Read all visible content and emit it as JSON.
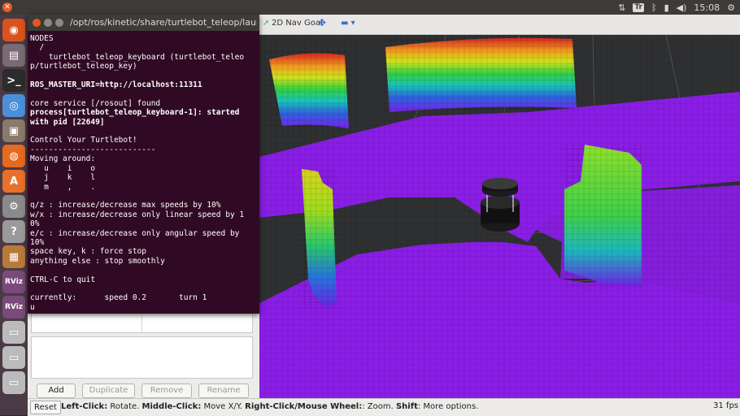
{
  "top_panel": {
    "keyboard_indicator": "Tr",
    "clock": "15:08"
  },
  "launcher": {
    "items": [
      {
        "name": "ubuntu-dash",
        "glyph": "◉"
      },
      {
        "name": "files",
        "glyph": "▤"
      },
      {
        "name": "terminal",
        "glyph": ">_"
      },
      {
        "name": "chromium",
        "glyph": "◎"
      },
      {
        "name": "file-manager",
        "glyph": "▣"
      },
      {
        "name": "firefox",
        "glyph": "◍"
      },
      {
        "name": "software-center",
        "glyph": "A"
      },
      {
        "name": "settings",
        "glyph": "⚙"
      },
      {
        "name": "help",
        "glyph": "?"
      },
      {
        "name": "package",
        "glyph": "▦"
      },
      {
        "name": "rviz-1",
        "glyph": "RViz"
      },
      {
        "name": "rviz-2",
        "glyph": "RViz"
      },
      {
        "name": "drive-1",
        "glyph": "▭"
      },
      {
        "name": "drive-2",
        "glyph": "▭"
      },
      {
        "name": "drive-3",
        "glyph": "▭"
      }
    ]
  },
  "rviz_toolbar": {
    "nav_goal_label": "2D Nav Goal"
  },
  "terminal": {
    "title": "/opt/ros/kinetic/share/turtlebot_teleop/launch",
    "lines": [
      {
        "text": "NODES",
        "bold": false
      },
      {
        "text": "  /",
        "bold": false
      },
      {
        "text": "    turtlebot_teleop_keyboard (turtlebot_teleo",
        "bold": false
      },
      {
        "text": "p/turtlebot_teleop_key)",
        "bold": false
      },
      {
        "text": "",
        "bold": false
      },
      {
        "text": "ROS_MASTER_URI=http://localhost:11311",
        "bold": true
      },
      {
        "text": "",
        "bold": false
      },
      {
        "text": "core service [/rosout] found",
        "bold": false
      },
      {
        "text": "process[turtlebot_teleop_keyboard-1]: started",
        "bold": true
      },
      {
        "text": "with pid [22649]",
        "bold": true
      },
      {
        "text": "",
        "bold": false
      },
      {
        "text": "Control Your Turtlebot!",
        "bold": false
      },
      {
        "text": "---------------------------",
        "bold": false
      },
      {
        "text": "Moving around:",
        "bold": false
      },
      {
        "text": "   u    i    o",
        "bold": false
      },
      {
        "text": "   j    k    l",
        "bold": false
      },
      {
        "text": "   m    ,    .",
        "bold": false
      },
      {
        "text": "",
        "bold": false
      },
      {
        "text": "q/z : increase/decrease max speeds by 10%",
        "bold": false
      },
      {
        "text": "w/x : increase/decrease only linear speed by 1",
        "bold": false
      },
      {
        "text": "0%",
        "bold": false
      },
      {
        "text": "e/c : increase/decrease only angular speed by",
        "bold": false
      },
      {
        "text": "10%",
        "bold": false
      },
      {
        "text": "space key, k : force stop",
        "bold": false
      },
      {
        "text": "anything else : stop smoothly",
        "bold": false
      },
      {
        "text": "",
        "bold": false
      },
      {
        "text": "CTRL-C to quit",
        "bold": false
      },
      {
        "text": "",
        "bold": false
      },
      {
        "text": "currently:      speed 0.2       turn 1",
        "bold": false
      },
      {
        "text": "u",
        "bold": false
      }
    ]
  },
  "panel_buttons": {
    "add": "Add",
    "duplicate": "Duplicate",
    "remove": "Remove",
    "rename": "Rename"
  },
  "status_bar": {
    "reset": "Reset",
    "hint_parts": [
      {
        "text": "Left-Click:",
        "bold": true
      },
      {
        "text": " Rotate. ",
        "bold": false
      },
      {
        "text": "Middle-Click:",
        "bold": true
      },
      {
        "text": " Move X/Y. ",
        "bold": false
      },
      {
        "text": "Right-Click/Mouse Wheel:",
        "bold": true
      },
      {
        "text": ": Zoom. ",
        "bold": false
      },
      {
        "text": "Shift",
        "bold": true
      },
      {
        "text": ": More options.",
        "bold": false
      }
    ],
    "fps": "31 fps"
  }
}
